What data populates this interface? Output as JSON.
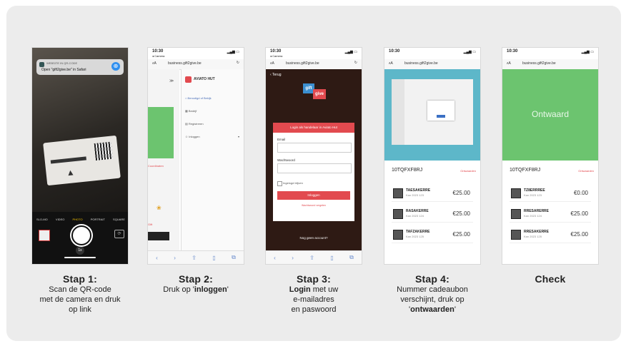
{
  "steps": [
    {
      "title": "Stap 1:",
      "lines": [
        "Scan de QR-code",
        "met de camera en druk",
        "op link"
      ],
      "phone": {
        "notif_app": "WEBSITE IN QR-CODE",
        "notif_text": "Open \"gift2give.be\" in Safari",
        "modes": [
          "SLO-MO",
          "VIDEO",
          "PHOTO",
          "PORTRAIT",
          "SQUARE"
        ],
        "zoom": "1x"
      }
    },
    {
      "title": "Stap 2:",
      "line_pre": "Druk op '",
      "line_bold": "inloggen",
      "line_post": "'",
      "phone": {
        "time": "10:30",
        "back_app": "◂ Camera",
        "url": "business.gift2give.be",
        "brand": "AVIATO HUT",
        "menu": [
          "Benodigd of Bekijk",
          "Bedrijf",
          "Registreren",
          "Inloggen"
        ],
        "side_label": "Coordinaten",
        "side_label2": "Gift",
        "close": "✕"
      }
    },
    {
      "title": "Stap 3:",
      "line1_bold": "Login",
      "line1_post": " met uw",
      "lines_rest": [
        "e-mailadres",
        "en paswoord"
      ],
      "phone": {
        "time": "10:30",
        "back_app": "◂ Camera",
        "url": "business.gift2give.be",
        "back_link": "‹ Terug",
        "logo_top": "gift",
        "logo_bottom": "give",
        "form_header": "Login als handelaar in Aviato Hut",
        "email_label": "Email",
        "password_label": "Wachtwoord",
        "remember": "Ingelogd blijven",
        "submit": "Inloggen",
        "forgot": "Wachtwoord vergeten",
        "no_account": "Nog geen account?"
      }
    },
    {
      "title": "Stap 4:",
      "lines": [
        "Nummer cadeaubon",
        "verschijnt, druk op"
      ],
      "line_last_pre": "'",
      "line_last_bold": "ontwaarden",
      "line_last_post": "'",
      "phone": {
        "time": "10:30",
        "url": "business.gift2give.be",
        "code": "10TQFXF8RJ",
        "action": "Ontwaarden",
        "vouchers": [
          {
            "code": "TAESAKERRE",
            "sub": "Kan 2023 123",
            "amount": "€25.00"
          },
          {
            "code": "RASAKERRE",
            "sub": "Kan 2023 124",
            "amount": "€25.00"
          },
          {
            "code": "TAFZAKERRE",
            "sub": "Kan 2023 125",
            "amount": "€25.00"
          }
        ]
      }
    },
    {
      "title": "Check",
      "phone": {
        "time": "10:30",
        "url": "business.gift2give.be",
        "banner": "Ontwaard",
        "code": "10TQFXF8RJ",
        "action": "Ontwaarden",
        "vouchers": [
          {
            "code": "TZ8ERRREE",
            "sub": "Kan 2023 123",
            "amount": "€0.00"
          },
          {
            "code": "RRESARERRE",
            "sub": "Kan 2023 124",
            "amount": "€25.00"
          },
          {
            "code": "RRESAKERRE",
            "sub": "Kan 2023 125",
            "amount": "€25.00"
          }
        ]
      }
    }
  ],
  "colors": {
    "accent": "#e24a4f",
    "green": "#6cc46f",
    "teal": "#5db7c9",
    "dark_bg": "#2e1a14"
  }
}
